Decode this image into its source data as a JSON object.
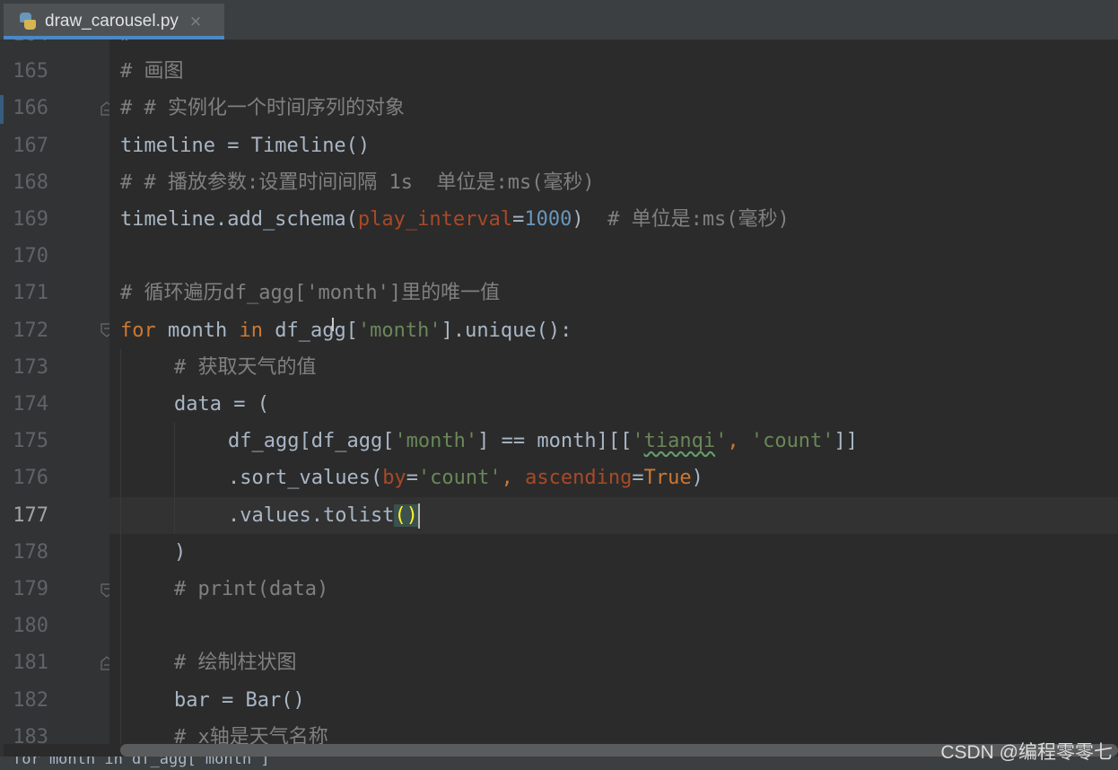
{
  "tab": {
    "filename": "draw_carousel.py",
    "close_glyph": "×",
    "icon": "python-file-icon"
  },
  "gutter": {
    "top_partial": "164",
    "line_numbers": [
      "165",
      "166",
      "167",
      "168",
      "169",
      "170",
      "171",
      "172",
      "173",
      "174",
      "175",
      "176",
      "177",
      "178",
      "179",
      "180",
      "181",
      "182",
      "183"
    ],
    "current_line": "177"
  },
  "code": {
    "l165": "# 画图",
    "l166": "# # 实例化一个时间序列的对象",
    "l167_var": "timeline",
    "l167_op": " = ",
    "l167_call": "Timeline()",
    "l168": "# # 播放参数:设置时间间隔 1s  单位是:ms(毫秒)",
    "l169_call": "timeline.add_schema(",
    "l169_param": "play_interval",
    "l169_eq": "=",
    "l169_num": "1000",
    "l169_close": ")  ",
    "l169_comment": "# 单位是:ms(毫秒)",
    "l171": "# 循环遍历df_agg['month']里的唯一值",
    "l172_for": "for",
    "l172_month": " month ",
    "l172_in": "in",
    "l172_df": " df_agg[",
    "l172_str": "'month'",
    "l172_end": "].unique():",
    "l173": "# 获取天气的值",
    "l174": "data = (",
    "l175_a": "df_agg[df_agg[",
    "l175_s1": "'month'",
    "l175_b": "] == month][[",
    "l175_s2a": "'",
    "l175_s2b": "tianqi",
    "l175_s2c": "'",
    "l175_comma": ", ",
    "l175_s3": "'count'",
    "l175_c": "]]",
    "l176_a": ".sort_values(",
    "l176_p1": "by",
    "l176_eq1": "=",
    "l176_s": "'count'",
    "l176_comma": ", ",
    "l176_p2": "ascending",
    "l176_eq2": "=",
    "l176_true": "True",
    "l176_close": ")",
    "l177_a": ".values.tolist",
    "l177_paren": "()",
    "l178": ")",
    "l179": "# print(data)",
    "l181": "# 绘制柱状图",
    "l182": "bar = Bar()",
    "l183": "# x轴是天气名称"
  },
  "bottom_peek": "for month in df_agg['month']",
  "watermark": "CSDN @编程零零七",
  "colors": {
    "background": "#2b2b2b",
    "gutter": "#313335",
    "comment": "#808080",
    "keyword": "#cc7832",
    "string": "#6a8759",
    "number": "#6897bb",
    "param": "#aa4926",
    "text": "#a9b7c6"
  }
}
